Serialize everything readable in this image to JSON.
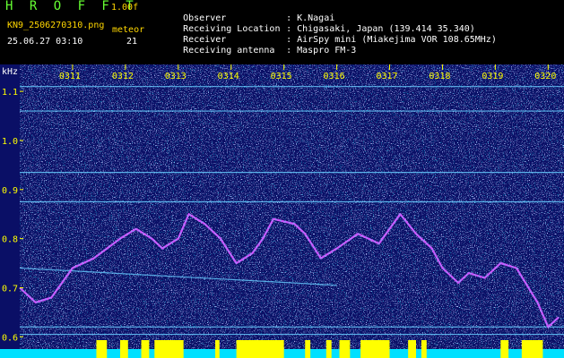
{
  "header": {
    "app_title": "H R O F F T",
    "version": "1.00f",
    "file_name": "KN9_2506270310.png",
    "meteor_label": "meteor",
    "meteor_count": "21",
    "date_time": "25.06.27 03:10",
    "info": [
      {
        "key": "Observer",
        "value": "K.Nagai"
      },
      {
        "key": "Receiving Location",
        "value": "Chigasaki, Japan (139.414 35.340)"
      },
      {
        "key": "Receiver",
        "value": "AirSpy mini (Miakejima VOR 108.65MHz)"
      },
      {
        "key": "Receiving antenna",
        "value": "Maspro FM-3"
      }
    ]
  },
  "colors": {
    "background": "#0a0f66",
    "noise_light": "#7a88ff",
    "noise_cyan": "#00d0ff",
    "signal_line": "#66ccff",
    "doppler_trace": "#d050ff",
    "meteor_bar": "#ffff00",
    "baseline_bar": "#00e0ff",
    "tick_label": "#ffff00",
    "y_axis_label": "#ffffff"
  },
  "chart_data": {
    "type": "heatmap",
    "ylabel": "kHz",
    "x_tick_labels": [
      "0311",
      "0312",
      "0313",
      "0314",
      "0315",
      "0316",
      "0317",
      "0318",
      "0319",
      "0320"
    ],
    "y_tick_labels": [
      "1.1",
      "1.0",
      "0.9",
      "0.8",
      "0.7",
      "0.6"
    ],
    "y_ticks": [
      1.1,
      1.0,
      0.9,
      0.8,
      0.7,
      0.6
    ],
    "ylim": [
      0.575,
      1.155
    ],
    "xlim": [
      10.0,
      20.3
    ],
    "x_ticks": [
      11,
      12,
      13,
      14,
      15,
      16,
      17,
      18,
      19,
      20
    ],
    "horizontal_lines_khz": [
      1.11,
      1.06,
      0.935,
      0.875,
      0.62,
      0.605
    ],
    "drifting_line": {
      "start_khz": 0.74,
      "end_khz": 0.705
    },
    "doppler_trace": [
      {
        "t": 10.0,
        "khz": 0.7
      },
      {
        "t": 10.3,
        "khz": 0.67
      },
      {
        "t": 10.6,
        "khz": 0.68
      },
      {
        "t": 11.0,
        "khz": 0.74
      },
      {
        "t": 11.4,
        "khz": 0.76
      },
      {
        "t": 11.9,
        "khz": 0.8
      },
      {
        "t": 12.2,
        "khz": 0.82
      },
      {
        "t": 12.5,
        "khz": 0.8
      },
      {
        "t": 12.7,
        "khz": 0.78
      },
      {
        "t": 13.0,
        "khz": 0.8
      },
      {
        "t": 13.2,
        "khz": 0.85
      },
      {
        "t": 13.5,
        "khz": 0.83
      },
      {
        "t": 13.8,
        "khz": 0.8
      },
      {
        "t": 14.1,
        "khz": 0.75
      },
      {
        "t": 14.4,
        "khz": 0.77
      },
      {
        "t": 14.6,
        "khz": 0.8
      },
      {
        "t": 14.8,
        "khz": 0.84
      },
      {
        "t": 15.2,
        "khz": 0.83
      },
      {
        "t": 15.4,
        "khz": 0.81
      },
      {
        "t": 15.7,
        "khz": 0.76
      },
      {
        "t": 16.0,
        "khz": 0.78
      },
      {
        "t": 16.4,
        "khz": 0.81
      },
      {
        "t": 16.8,
        "khz": 0.79
      },
      {
        "t": 17.0,
        "khz": 0.82
      },
      {
        "t": 17.2,
        "khz": 0.85
      },
      {
        "t": 17.5,
        "khz": 0.81
      },
      {
        "t": 17.8,
        "khz": 0.78
      },
      {
        "t": 18.0,
        "khz": 0.74
      },
      {
        "t": 18.3,
        "khz": 0.71
      },
      {
        "t": 18.5,
        "khz": 0.73
      },
      {
        "t": 18.8,
        "khz": 0.72
      },
      {
        "t": 19.1,
        "khz": 0.75
      },
      {
        "t": 19.4,
        "khz": 0.74
      },
      {
        "t": 19.8,
        "khz": 0.67
      },
      {
        "t": 20.0,
        "khz": 0.62
      },
      {
        "t": 20.2,
        "khz": 0.64
      }
    ],
    "meteor_bursts": [
      {
        "start": 11.45,
        "end": 11.65
      },
      {
        "start": 11.9,
        "end": 12.05
      },
      {
        "start": 12.3,
        "end": 12.45
      },
      {
        "start": 12.55,
        "end": 13.1
      },
      {
        "start": 13.7,
        "end": 13.78
      },
      {
        "start": 14.1,
        "end": 15.0
      },
      {
        "start": 15.4,
        "end": 15.5
      },
      {
        "start": 15.8,
        "end": 15.9
      },
      {
        "start": 16.05,
        "end": 16.25
      },
      {
        "start": 16.45,
        "end": 17.0
      },
      {
        "start": 17.35,
        "end": 17.5
      },
      {
        "start": 17.6,
        "end": 17.7
      },
      {
        "start": 19.1,
        "end": 19.25
      },
      {
        "start": 19.5,
        "end": 19.9
      }
    ]
  }
}
